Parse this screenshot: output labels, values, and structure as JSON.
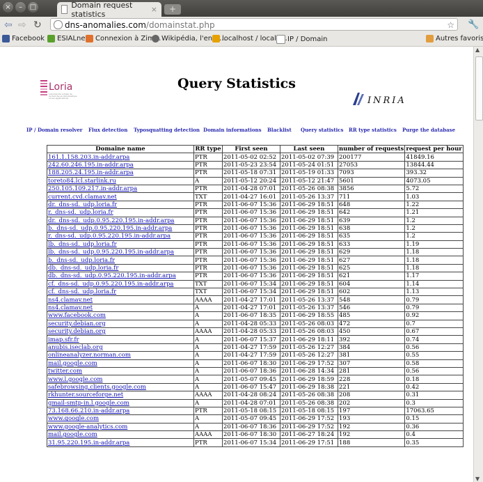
{
  "browser": {
    "tab_title": "Domain request statistics",
    "tab_close": "×",
    "new_tab": "+",
    "url_host": "dns-anomalies.com",
    "url_path": "/domainstat.php",
    "bookmarks": [
      {
        "label": "Facebook",
        "color": "#3b5998"
      },
      {
        "label": "ESIALnet",
        "color": "#5aa02c"
      },
      {
        "label": "Connexion à Zim...",
        "color": "#e0712c"
      },
      {
        "label": "Wikipédia, l'ency...",
        "color": "#666666"
      },
      {
        "label": "localhost / localh...",
        "color": "#e5a100"
      },
      {
        "label": "IP / Domain",
        "color": "#bbbbbb"
      }
    ],
    "other_bookmarks": "Autres favoris"
  },
  "header": {
    "title": "Query Statistics",
    "loria_logo": "Loria",
    "loria_tagline": "Laboratoire lorrain de recherche en informatique et ses applications",
    "inria_logo": "INRIA"
  },
  "menu": [
    "IP / Domain resolver",
    "Flux detection",
    "Typosquatting detection",
    "Domain informations",
    "Blacklist",
    "Query statistics",
    "RR type statistics",
    "Purge the database"
  ],
  "table": {
    "headers": [
      "Domaine name",
      "RR type",
      "First seen",
      "Last seen",
      "number of requests",
      "request per hour"
    ],
    "rows": [
      [
        "161.1.158.203.in-addr.arpa",
        "PTR",
        "2011-05-02 02:52",
        "2011-05-02 07:39",
        "200177",
        "41849.16"
      ],
      [
        "242.60.246.195.in-addr.arpa",
        "PTR",
        "2011-05-23 23:54",
        "2011-05-24 01:51",
        "27053",
        "13844.44"
      ],
      [
        "188.205.24.195.in-addr.arpa",
        "PTR",
        "2011-05-18 07:31",
        "2011-05-19 01:33",
        "7093",
        "393.32"
      ],
      [
        "toreto84.lcl.starlink.ru",
        "A",
        "2011-05-12 20:24",
        "2011-05-12 21:47",
        "5601",
        "4073.05"
      ],
      [
        "250.105.109.217.in-addr.arpa",
        "PTR",
        "2011-04-28 07:01",
        "2011-05-26 08:38",
        "3856",
        "5.72"
      ],
      [
        "current.cvd.clamav.net",
        "TXT",
        "2011-04-27 16:01",
        "2011-05-26 13:37",
        "711",
        "1.03"
      ],
      [
        "dr._dns-sd._udp.loria.fr",
        "PTR",
        "2011-06-07 15:36",
        "2011-06-29 18:51",
        "648",
        "1.22"
      ],
      [
        "r._dns-sd._udp.loria.fr",
        "PTR",
        "2011-06-07 15:36",
        "2011-06-29 18:51",
        "642",
        "1.21"
      ],
      [
        "dr._dns-sd._udp.0.95.220.195.in-addr.arpa",
        "PTR",
        "2011-06-07 15:36",
        "2011-06-29 18:51",
        "639",
        "1.2"
      ],
      [
        "b._dns-sd._udp.0.95.220.195.in-addr.arpa",
        "PTR",
        "2011-06-07 15:36",
        "2011-06-29 18:51",
        "638",
        "1.2"
      ],
      [
        "r._dns-sd._udp.0.95.220.195.in-addr.arpa",
        "PTR",
        "2011-06-07 15:36",
        "2011-06-29 18:51",
        "635",
        "1.2"
      ],
      [
        "lb._dns-sd._udp.loria.fr",
        "PTR",
        "2011-06-07 15:36",
        "2011-06-29 18:51",
        "633",
        "1.19"
      ],
      [
        "lb._dns-sd._udp.0.95.220.195.in-addr.arpa",
        "PTR",
        "2011-06-07 15:36",
        "2011-06-29 18:51",
        "629",
        "1.18"
      ],
      [
        "b._dns-sd._udp.loria.fr",
        "PTR",
        "2011-06-07 15:36",
        "2011-06-29 18:51",
        "627",
        "1.18"
      ],
      [
        "db._dns-sd._udp.loria.fr",
        "PTR",
        "2011-06-07 15:36",
        "2011-06-29 18:51",
        "625",
        "1.18"
      ],
      [
        "db._dns-sd._udp.0.95.220.195.in-addr.arpa",
        "PTR",
        "2011-06-07 15:36",
        "2011-06-29 18:51",
        "621",
        "1.17"
      ],
      [
        "cf._dns-sd._udp.0.95.220.195.in-addr.arpa",
        "TXT",
        "2011-06-07 15:34",
        "2011-06-29 18:51",
        "604",
        "1.14"
      ],
      [
        "cf._dns-sd._udp.loria.fr",
        "TXT",
        "2011-06-07 15:34",
        "2011-06-29 18:51",
        "602",
        "1.13"
      ],
      [
        "ns4.clamav.net",
        "AAAA",
        "2011-04-27 17:01",
        "2011-05-26 13:37",
        "548",
        "0.79"
      ],
      [
        "ns4.clamav.net",
        "A",
        "2011-04-27 17:01",
        "2011-05-26 13:37",
        "546",
        "0.79"
      ],
      [
        "www.facebook.com",
        "A",
        "2011-06-07 18:35",
        "2011-06-29 18:55",
        "485",
        "0.92"
      ],
      [
        "security.debian.org",
        "A",
        "2011-04-28 05:33",
        "2011-05-26 08:03",
        "472",
        "0.7"
      ],
      [
        "security.debian.org",
        "AAAA",
        "2011-04-28 05:33",
        "2011-05-26 08:03",
        "450",
        "0.67"
      ],
      [
        "imap.sfr.fr",
        "A",
        "2011-06-07 15:37",
        "2011-06-29 18:11",
        "392",
        "0.74"
      ],
      [
        "anubis.iseclab.org",
        "A",
        "2011-04-27 17:59",
        "2011-05-26 12:27",
        "384",
        "0.56"
      ],
      [
        "onlineanalyzer.norman.com",
        "A",
        "2011-04-27 17:59",
        "2011-05-26 12:27",
        "381",
        "0.55"
      ],
      [
        "mail.google.com",
        "A",
        "2011-06-07 18:30",
        "2011-06-29 17:52",
        "307",
        "0.58"
      ],
      [
        "twitter.com",
        "A",
        "2011-06-07 18:36",
        "2011-06-28 14:34",
        "281",
        "0.56"
      ],
      [
        "www.l.google.com",
        "A",
        "2011-05-07 09:45",
        "2011-06-29 18:59",
        "228",
        "0.18"
      ],
      [
        "safebrowsing.clients.google.com",
        "A",
        "2011-06-07 15:47",
        "2011-06-29 18:38",
        "221",
        "0.42"
      ],
      [
        "rkhunter.sourceforge.net",
        "AAAA",
        "2011-04-28 08:24",
        "2011-05-26 08:38",
        "208",
        "0.31"
      ],
      [
        "gmail-smtp-in.l.google.com",
        "A",
        "2011-04-28 07:01",
        "2011-05-26 08:38",
        "202",
        "0.3"
      ],
      [
        "73.168.66.210.in-addr.arpa",
        "PTR",
        "2011-05-18 08:15",
        "2011-05-18 08:15",
        "197",
        "17063.65"
      ],
      [
        "www.google.com",
        "A",
        "2011-05-07 09:45",
        "2011-06-29 17:52",
        "193",
        "0.15"
      ],
      [
        "www.google-analytics.com",
        "A",
        "2011-06-07 18:36",
        "2011-06-29 17:52",
        "192",
        "0.36"
      ],
      [
        "mail.google.com",
        "AAAA",
        "2011-06-07 18:30",
        "2011-06-27 18:24",
        "192",
        "0.4"
      ],
      [
        "31.95.220.195.in-addr.arpa",
        "PTR",
        "2011-06-07 15:34",
        "2011-06-29 17:51",
        "188",
        "0.35"
      ]
    ]
  }
}
